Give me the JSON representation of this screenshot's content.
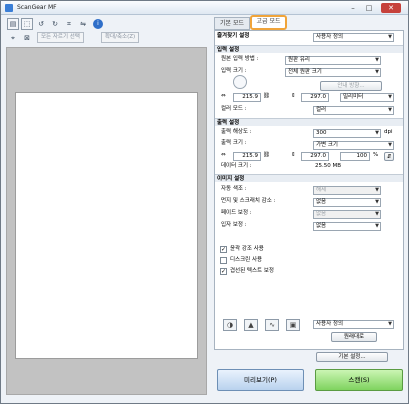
{
  "window": {
    "title": "ScanGear MF",
    "minimize": "–",
    "maximize": "□",
    "close": "✕"
  },
  "left": {
    "toolbar_icons": [
      "thumbnail-view-icon",
      "whole-image-icon",
      "rotate-left-icon",
      "rotate-right-icon",
      "crop-icon",
      "info-icon"
    ],
    "toolbar2_icons": [
      "auto-crop-icon",
      "clear-icon"
    ],
    "clear_all_label": "모든 자르기 선택",
    "zoom_label": "확대/축소(Z)"
  },
  "tabs": {
    "basic": "기본 모드",
    "advanced": "고급 모드"
  },
  "favorites": {
    "label": "즐겨찾기 설정",
    "value": "사용자 정의"
  },
  "input": {
    "section": "입력 설정",
    "source_label": "원본 입력 방법 :",
    "source_value": "원판 유리",
    "size_label": "입력 크기 :",
    "size_value": "전체 원판 크기",
    "guide_label": "안내 방향...",
    "width": "215.9",
    "height": "297.0",
    "unit": "밀리미터",
    "color_label": "컬러 모드 :",
    "color_value": "컬러"
  },
  "output": {
    "section": "출력 설정",
    "resolution_label": "출력 해상도 :",
    "resolution_value": "300",
    "dpi": "dpi",
    "size_label": "출력 크기 :",
    "size_value": "가변 크기",
    "width": "215.9",
    "height": "297.0",
    "scale": "100",
    "percent": "%",
    "data_label": "데이터 크기 :",
    "data_value": "25.50 MB"
  },
  "image": {
    "section": "이미지 설정",
    "rows": [
      {
        "label": "자동 색조 :",
        "value": "해제",
        "disabled": true
      },
      {
        "label": "먼지 및 스크래치 감소 :",
        "value": "없음",
        "disabled": false
      },
      {
        "label": "페이드 보정 :",
        "value": "없음",
        "disabled": true
      },
      {
        "label": "입자 보정 :",
        "value": "없음",
        "disabled": false
      }
    ],
    "checks": [
      {
        "label": "윤곽 강조 사용",
        "checked": true
      },
      {
        "label": "디스크린 사용",
        "checked": false
      },
      {
        "label": "겹선된 텍스트 보정",
        "checked": true
      }
    ]
  },
  "bottom": {
    "tone_icons": [
      "brightness-icon",
      "histogram-icon",
      "tone-curve-icon",
      "threshold-icon"
    ],
    "tone_value": "사용자 정의",
    "reset_label": "원래대로",
    "prefs_label": "기본 설정...",
    "preview_label": "미리보기(P)",
    "scan_label": "스캔(S)"
  },
  "colors": {
    "scan_button": "#7fd35f",
    "active_tab_border": "#f0a43a",
    "preview_bg": "#c2c2c2"
  }
}
